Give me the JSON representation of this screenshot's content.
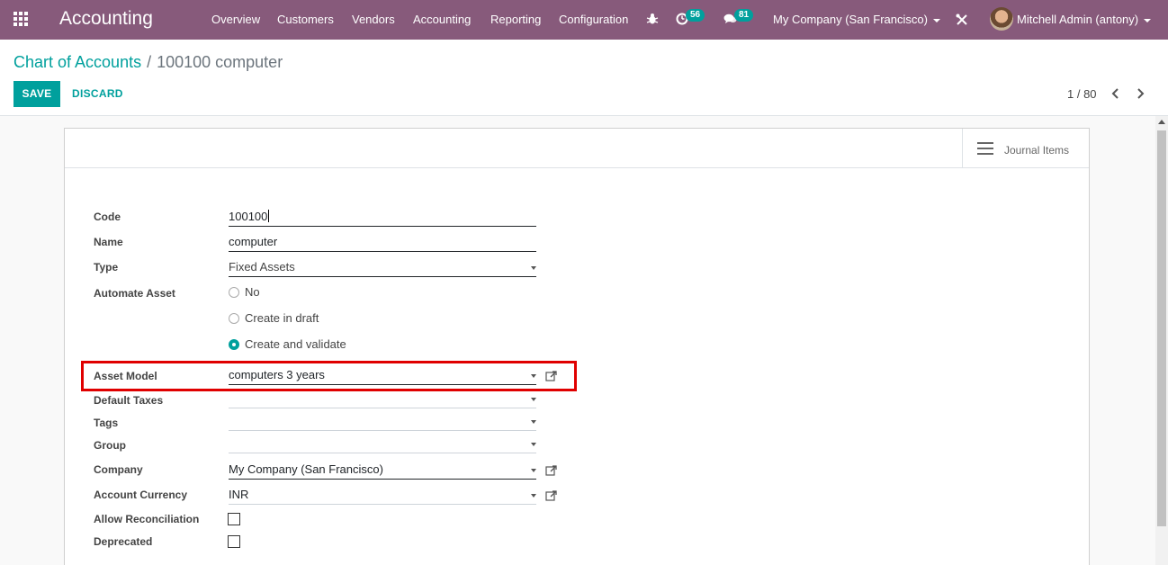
{
  "navbar": {
    "brand": "Accounting",
    "menu": [
      "Overview",
      "Customers",
      "Vendors",
      "Accounting",
      "Reporting",
      "Configuration"
    ],
    "activities_badge": "56",
    "messages_badge": "81",
    "company": "My Company (San Francisco)",
    "user": "Mitchell Admin (antony)"
  },
  "breadcrumb": {
    "parent": "Chart of Accounts",
    "separator": "/",
    "current": "100100 computer"
  },
  "actions": {
    "save": "SAVE",
    "discard": "DISCARD"
  },
  "pager": {
    "text": "1 / 80"
  },
  "button_box": {
    "journal_items": "Journal Items"
  },
  "form": {
    "code_label": "Code",
    "code_value": "100100",
    "name_label": "Name",
    "name_value": "computer",
    "type_label": "Type",
    "type_value": "Fixed Assets",
    "automate_label": "Automate Asset",
    "automate_options": [
      "No",
      "Create in draft",
      "Create and validate"
    ],
    "automate_selected": "Create and validate",
    "asset_model_label": "Asset Model",
    "asset_model_value": "computers 3 years",
    "default_taxes_label": "Default Taxes",
    "tags_label": "Tags",
    "group_label": "Group",
    "company_label": "Company",
    "company_value": "My Company (San Francisco)",
    "currency_label": "Account Currency",
    "currency_value": "INR",
    "reconcile_label": "Allow Reconciliation",
    "deprecated_label": "Deprecated"
  },
  "colors": {
    "navbar": "#875a7b",
    "primary": "#00a09d",
    "highlight": "#e00000"
  }
}
